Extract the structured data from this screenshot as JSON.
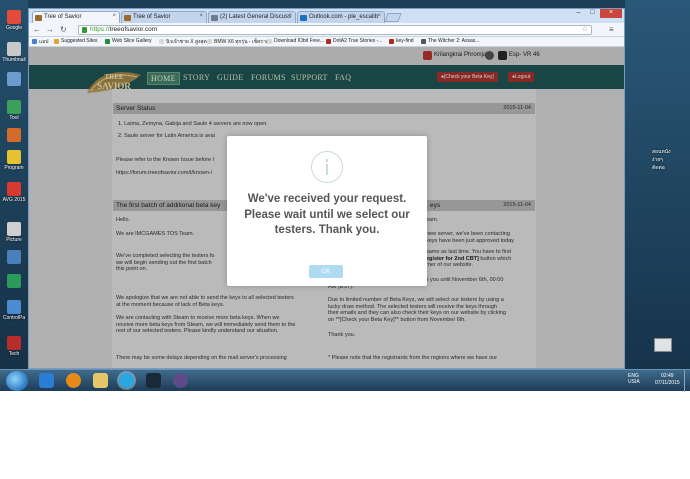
{
  "desktop": {
    "left_icons": [
      "Google",
      "Thumbnail",
      "",
      "Tool",
      "",
      "Program",
      "AVG 2015",
      "Picture",
      "",
      "",
      "ControlPa",
      "Tech"
    ],
    "right_texts": [
      "สอนหนัง",
      "ง่ายๆ",
      "ตัดต่อ"
    ]
  },
  "browser": {
    "tabs": [
      {
        "label": "Tree of Savior",
        "active": true
      },
      {
        "label": "Tree of Savior",
        "active": false
      },
      {
        "label": "(2) Latest General Discuss",
        "active": false
      },
      {
        "label": "Outlook.com - ple_escalib",
        "active": false
      }
    ],
    "url_scheme": "https://",
    "url_host": "treeofsavior.com",
    "bookmarks": [
      "แอป",
      "Suggested Sites",
      "Web Slice Gallery",
      "นิวเจ้าชาย X สูงสุด",
      "BMW X6 ทุกรุ่น - เช็คราคา",
      "Download IObit Free...",
      "DotA2 True Stories -...",
      "key-find",
      "The Witcher 2: Assas..."
    ]
  },
  "site": {
    "user": {
      "name": "Krilangkrai Phromjai",
      "region": "Esp- VR 46"
    },
    "nav": [
      "HOME",
      "STORY",
      "GUIDE",
      "FORUMS",
      "SUPPORT",
      "FAQ"
    ],
    "check_beta_key": "●[Check your Beta Key]",
    "logout": "●Logout",
    "status": {
      "title": "Server Status",
      "date": "2015-11-04",
      "line1": "1. Laima, Zemyna, Gabija and Saule 4 servers are now open.",
      "line2": "2. Saule server for Latin America is avai",
      "line3": "Please refer to the Known Issue before l",
      "line4": "https://forum.treeofsavior.com/t/known-i"
    },
    "post_left": {
      "title": "The first batch of additional beta key",
      "p1": "Hello.",
      "p2": "We are IMCGAMES TOS Team.",
      "p3": "We've completed selecting the testers fo",
      "p3b": "we will begin sending out the first batch",
      "p3c": "this point on.",
      "p4": "We apologize that we are not able to send the keys to all selected testers",
      "p4b": "at the moment because of lack of Beta keys.",
      "p5": "We are contacting with Steam to receive more beta keys. When we",
      "p5b": "receive more beta keys from Steam, we will immediately send them to the",
      "p5c": "rest of our selected testers. Please kindly understand our situation.",
      "p6": "There may be some delays depending on the mail server's processing"
    },
    "post_right": {
      "title": "eys",
      "date": "2015-11-04",
      "p1": "eam.",
      "p2": "new server, we've been contacting",
      "p2b": "keys have been just approved today",
      "p3": "same as last time.  You have to first",
      "p3b": "egister for 2nd CBT]",
      "p3b2": " button which",
      "p3c": "rner of our website.",
      "p4": "We are going to accept registrations from you until November 6th, 00:00",
      "p4b": "AM (EST).",
      "p5": "Due to limited number of Beta Keys, we will select our testers by using a",
      "p5b": "lucky draw method. The selected testers will receive the keys through",
      "p5c": "their emails and they can also check their keys on our website by clicking",
      "p5d": "on **[Check your Beta Key]** button from November 6th.",
      "p6": "Thank you.",
      "p7": "* Please note that the registrants from the regions where we have our"
    }
  },
  "modal": {
    "line1": "We've received your request.",
    "line2": "Please wait until we select our",
    "line3": "testers. Thank you.",
    "ok": "OK"
  },
  "taskbar": {
    "lang": "ENG",
    "region": "USIA",
    "time": "02:49",
    "date": "07/11/2015"
  }
}
